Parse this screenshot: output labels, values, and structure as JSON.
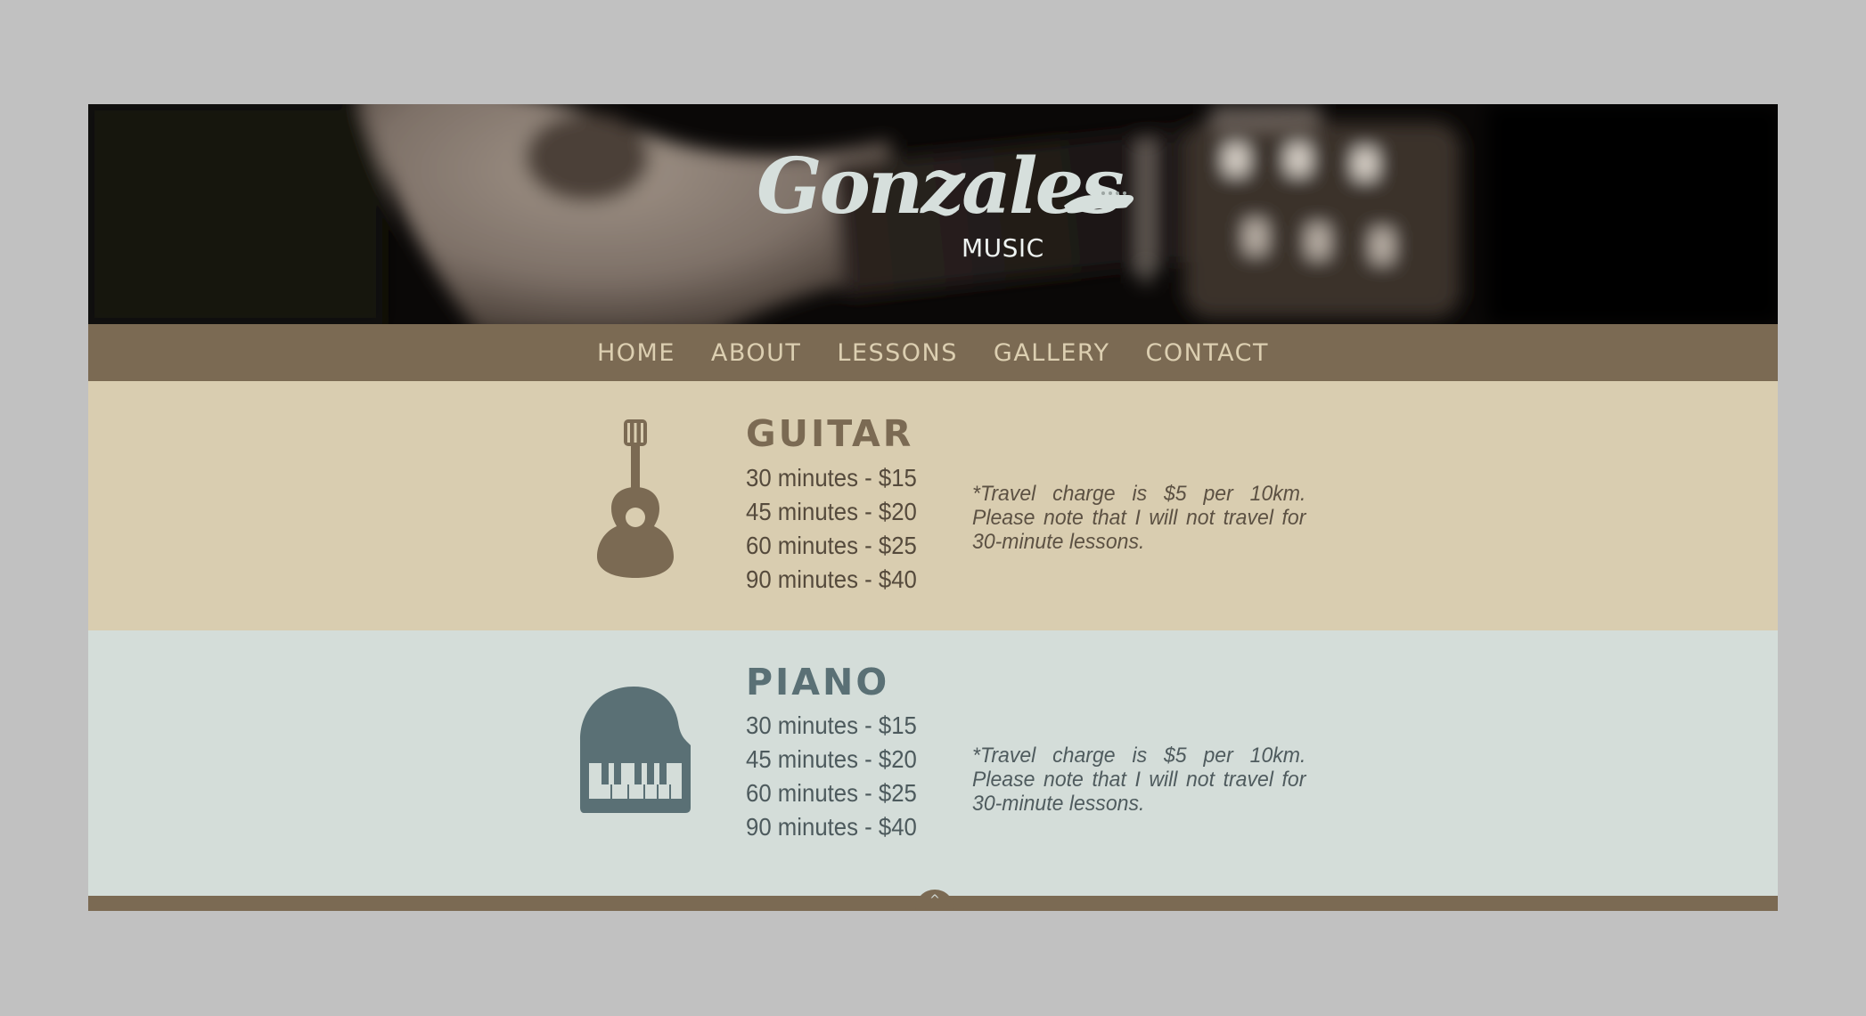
{
  "logo": {
    "script": "Gonzales",
    "sub": "MUSIC"
  },
  "nav": {
    "items": [
      {
        "label": "HOME"
      },
      {
        "label": "ABOUT"
      },
      {
        "label": "LESSONS"
      },
      {
        "label": "GALLERY"
      },
      {
        "label": "CONTACT"
      }
    ]
  },
  "lessons": [
    {
      "title": "GUITAR",
      "icon": "guitar-icon",
      "accent": "#7b6a53",
      "background": "#d9cdb0",
      "prices": [
        "30 minutes - $15",
        "45 minutes - $20",
        "60 minutes - $25",
        "90 minutes - $40"
      ],
      "note": "*Travel charge is $5 per 10km. Please note that I will not travel for 30-minute lessons."
    },
    {
      "title": "PIANO",
      "icon": "piano-icon",
      "accent": "#5a7075",
      "background": "#d4ddd9",
      "prices": [
        "30 minutes - $15",
        "45 minutes - $20",
        "60 minutes - $25",
        "90 minutes - $40"
      ],
      "note": "*Travel charge is $5 per 10km. Please note that I will not travel for 30-minute lessons."
    }
  ],
  "footer": {
    "back_to_top": "^",
    "icon": "chevron-up-icon"
  },
  "colors": {
    "page_bg": "#c1c1c1",
    "nav_bg": "#7b6a53",
    "nav_text": "#dccfb1"
  }
}
